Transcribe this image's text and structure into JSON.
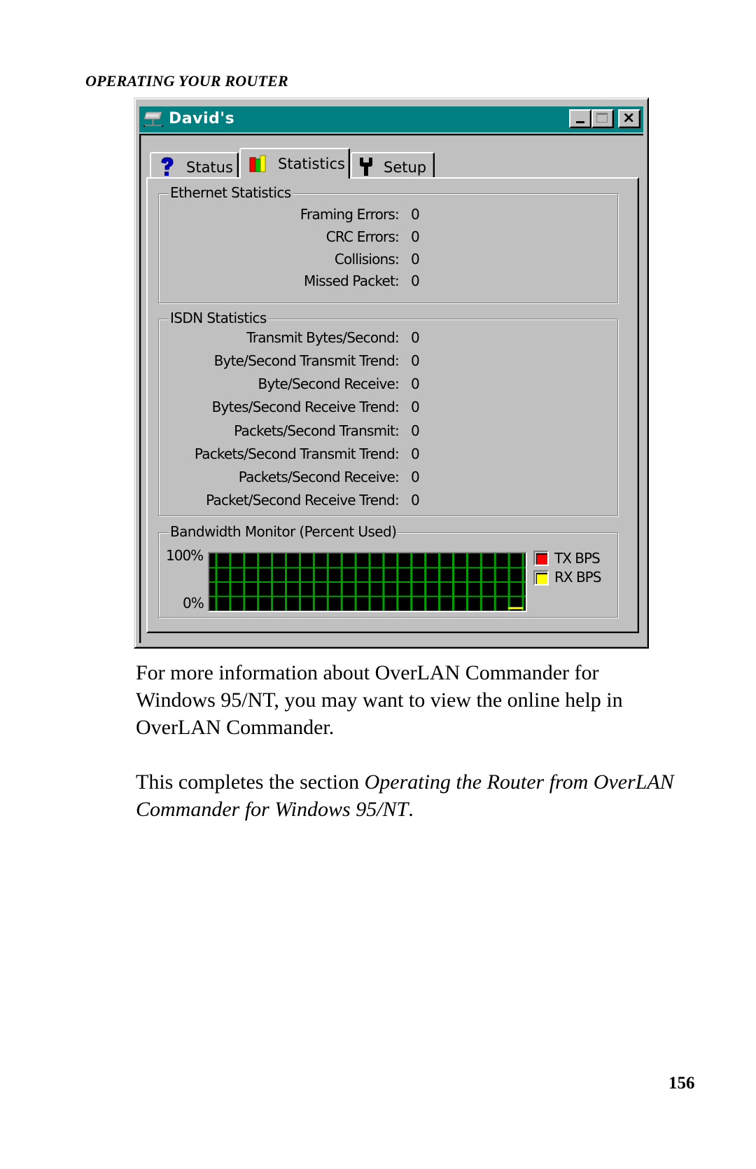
{
  "page": {
    "running_head": "OPERATING YOUR ROUTER",
    "page_number": "156",
    "paragraphs": [
      {
        "segments": [
          {
            "text": "For more information about OverLAN Commander for Windows 95/NT, you may want to view the online help in OverLAN  Commander.",
            "italic": false
          }
        ]
      },
      {
        "segments": [
          {
            "text": "This completes the section ",
            "italic": false
          },
          {
            "text": "Operating the Router from OverLAN Commander for Windows 95/NT",
            "italic": true
          },
          {
            "text": ".",
            "italic": false
          }
        ]
      }
    ]
  },
  "window": {
    "title": "David's",
    "title_icon": "network-computer-icon",
    "controls": {
      "minimize": "minimize",
      "maximize": "maximize",
      "close": "×"
    },
    "colors": {
      "titlebar": "#008080",
      "face": "#c0c0c0"
    },
    "tabs": [
      {
        "label": "Status",
        "icon": "question-mark-icon",
        "active": false
      },
      {
        "label": "Statistics",
        "icon": "bar-chart-icon",
        "active": true
      },
      {
        "label": "Setup",
        "icon": "wrench-icon",
        "active": false
      }
    ],
    "ethernet": {
      "title": "Ethernet Statistics",
      "rows": [
        {
          "label": "Framing Errors:",
          "value": "0"
        },
        {
          "label": "CRC Errors:",
          "value": "0"
        },
        {
          "label": "Collisions:",
          "value": "0"
        },
        {
          "label": "Missed Packet:",
          "value": "0"
        }
      ]
    },
    "isdn": {
      "title": "ISDN Statistics",
      "rows": [
        {
          "label": "Transmit Bytes/Second:",
          "value": "0"
        },
        {
          "label": "Byte/Second Transmit Trend:",
          "value": "0"
        },
        {
          "label": "Byte/Second Receive:",
          "value": "0"
        },
        {
          "label": "Bytes/Second Receive Trend:",
          "value": "0"
        },
        {
          "label": "Packets/Second Transmit:",
          "value": "0"
        },
        {
          "label": "Packets/Second Transmit Trend:",
          "value": "0"
        },
        {
          "label": "Packets/Second Receive:",
          "value": "0"
        },
        {
          "label": "Packet/Second Receive Trend:",
          "value": "0"
        }
      ]
    },
    "bandwidth": {
      "title": "Bandwidth Monitor (Percent Used)",
      "y_max_label": "100%",
      "y_min_label": "0%",
      "legend": [
        {
          "label": "TX BPS",
          "color": "#ff0000"
        },
        {
          "label": "RX BPS",
          "color": "#ffff00"
        }
      ],
      "grid_color": "#00a000"
    }
  },
  "chart_data": {
    "type": "line",
    "title": "Bandwidth Monitor (Percent Used)",
    "ylabel": "Percent Used",
    "ylim": [
      0,
      100
    ],
    "ytick_labels": [
      "100%",
      "0%"
    ],
    "grid": true,
    "legend_position": "right",
    "x_samples": 22,
    "series": [
      {
        "name": "TX BPS",
        "color": "#ff0000",
        "values": [
          0,
          0,
          0,
          0,
          0,
          0,
          0,
          0,
          0,
          0,
          0,
          0,
          0,
          0,
          0,
          0,
          0,
          0,
          0,
          0,
          0,
          0
        ]
      },
      {
        "name": "RX BPS",
        "color": "#ffff00",
        "values": [
          0,
          0,
          0,
          0,
          0,
          0,
          0,
          0,
          0,
          0,
          0,
          0,
          0,
          0,
          0,
          0,
          0,
          0,
          0,
          0,
          1,
          1
        ]
      }
    ]
  }
}
